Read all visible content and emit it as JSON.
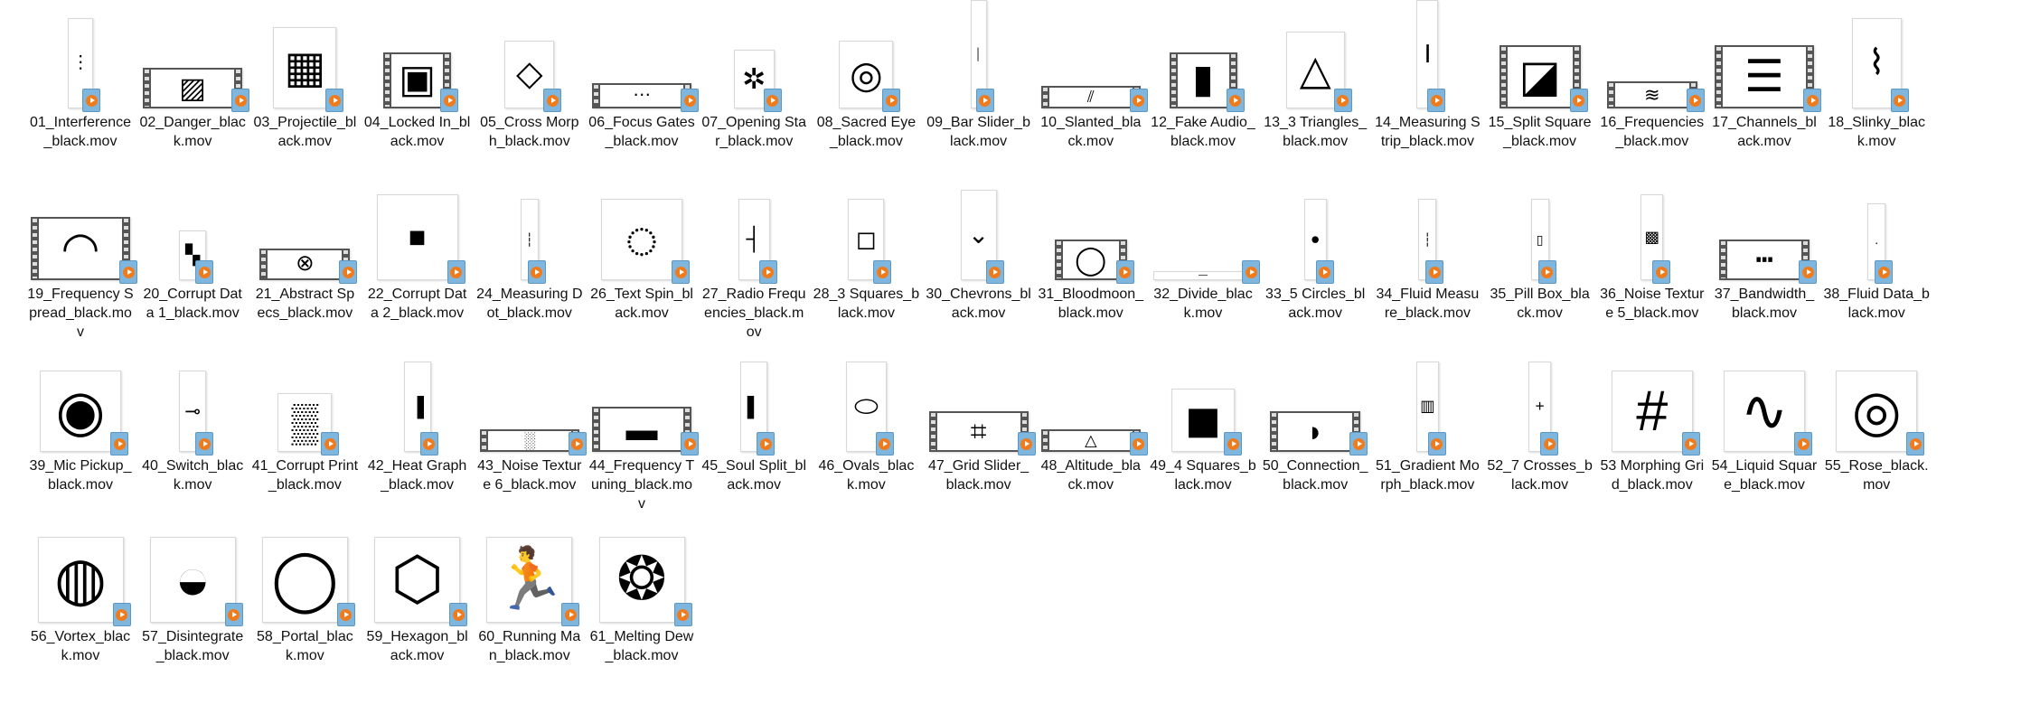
{
  "view": "file-explorer-large-icons",
  "badge_icon": "video-play-badge-icon",
  "colors": {
    "badge_bg": "#7fb6de",
    "badge_play": "#f07b1d"
  },
  "files": [
    {
      "name": "01_Interference_black.mov"
    },
    {
      "name": "02_Danger_black.mov"
    },
    {
      "name": "03_Projectile_black.mov"
    },
    {
      "name": "04_Locked In_black.mov"
    },
    {
      "name": "05_Cross Morph_black.mov"
    },
    {
      "name": "06_Focus Gates_black.mov"
    },
    {
      "name": "07_Opening Star_black.mov"
    },
    {
      "name": "08_Sacred Eye_black.mov"
    },
    {
      "name": "09_Bar Slider_black.mov"
    },
    {
      "name": "10_Slanted_black.mov"
    },
    {
      "name": "12_Fake Audio_black.mov"
    },
    {
      "name": "13_3 Triangles_black.mov"
    },
    {
      "name": "14_Measuring Strip_black.mov"
    },
    {
      "name": "15_Split Square_black.mov"
    },
    {
      "name": "16_Frequencies_black.mov"
    },
    {
      "name": "17_Channels_black.mov"
    },
    {
      "name": "18_Slinky_black.mov"
    },
    {
      "name": "19_Frequency Spread_black.mov"
    },
    {
      "name": "20_Corrupt Data 1_black.mov"
    },
    {
      "name": "21_Abstract Specs_black.mov"
    },
    {
      "name": "22_Corrupt Data 2_black.mov"
    },
    {
      "name": "24_Measuring Dot_black.mov"
    },
    {
      "name": "26_Text Spin_black.mov"
    },
    {
      "name": "27_Radio Frequencies_black.mov"
    },
    {
      "name": "28_3 Squares_black.mov"
    },
    {
      "name": "30_Chevrons_black.mov"
    },
    {
      "name": "31_Bloodmoon_black.mov"
    },
    {
      "name": "32_Divide_black.mov"
    },
    {
      "name": "33_5 Circles_black.mov"
    },
    {
      "name": "34_Fluid Measure_black.mov"
    },
    {
      "name": "35_Pill Box_black.mov"
    },
    {
      "name": "36_Noise Texture 5_black.mov"
    },
    {
      "name": "37_Bandwidth_black.mov"
    },
    {
      "name": "38_Fluid Data_black.mov"
    },
    {
      "name": "39_Mic Pickup_black.mov"
    },
    {
      "name": "40_Switch_black.mov"
    },
    {
      "name": "41_Corrupt Print_black.mov"
    },
    {
      "name": "42_Heat Graph_black.mov"
    },
    {
      "name": "43_Noise Texture 6_black.mov"
    },
    {
      "name": "44_Frequency Tuning_black.mov"
    },
    {
      "name": "45_Soul Split_black.mov"
    },
    {
      "name": "46_Ovals_black.mov"
    },
    {
      "name": "47_Grid Slider_black.mov"
    },
    {
      "name": "48_Altitude_black.mov"
    },
    {
      "name": "49_4 Squares_black.mov"
    },
    {
      "name": "50_Connection_black.mov"
    },
    {
      "name": "51_Gradient Morph_black.mov"
    },
    {
      "name": "52_7 Crosses_black.mov"
    },
    {
      "name": "53 Morphing Grid_black.mov"
    },
    {
      "name": "54_Liquid Square_black.mov"
    },
    {
      "name": "55_Rose_black.mov"
    },
    {
      "name": "56_Vortex_black.mov"
    },
    {
      "name": "57_Disintegrate_black.mov"
    },
    {
      "name": "58_Portal_black.mov"
    },
    {
      "name": "59_Hexagon_black.mov"
    },
    {
      "name": "60_Running Man_black.mov"
    },
    {
      "name": "61_Melting Dew_black.mov"
    }
  ]
}
